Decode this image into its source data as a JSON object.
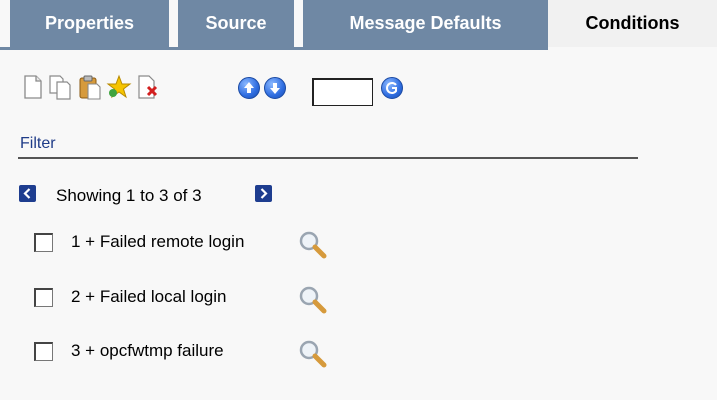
{
  "tabs": [
    {
      "label": "Properties",
      "active": false
    },
    {
      "label": "Source",
      "active": false
    },
    {
      "label": "Message Defaults",
      "active": false
    },
    {
      "label": "Conditions",
      "active": true
    }
  ],
  "toolbar": {
    "icons": [
      "new-icon",
      "copy-icon",
      "paste-icon",
      "favorite-star-icon",
      "delete-icon",
      "move-up-icon",
      "move-down-icon",
      "go-icon"
    ],
    "position_input_value": ""
  },
  "filter": {
    "label": "Filter"
  },
  "pager": {
    "text": "Showing 1 to 3 of 3"
  },
  "conditions": [
    {
      "label": "1 + Failed remote login",
      "checked": false
    },
    {
      "label": "2 + Failed local login",
      "checked": false
    },
    {
      "label": "3 + opcfwtmp failure",
      "checked": false
    }
  ],
  "colors": {
    "tab_bg": "#6f88a4",
    "active_tab_bg": "#f1f1f1",
    "accent_blue": "#1e3d8f",
    "filter_text": "#1f3c88"
  }
}
